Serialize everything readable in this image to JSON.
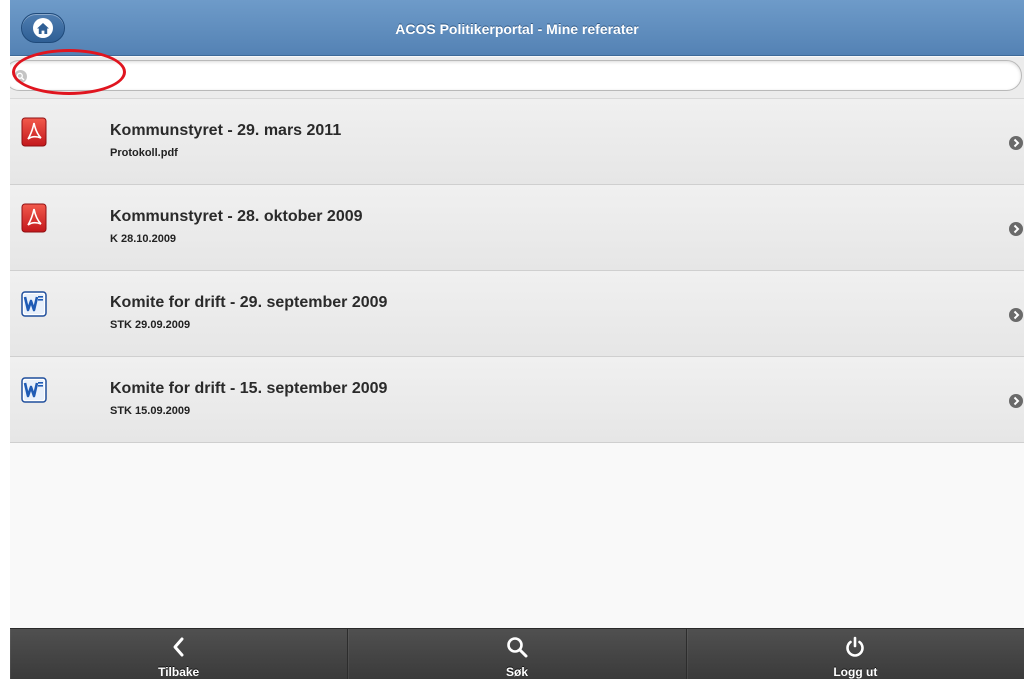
{
  "header": {
    "title": "ACOS Politikerportal - Mine referater",
    "home_icon": "home-icon"
  },
  "search": {
    "placeholder": "",
    "value": "",
    "icon": "search-icon"
  },
  "items": [
    {
      "title": "Kommunstyret - 29. mars 2011",
      "subtitle": "Protokoll.pdf",
      "file_type": "pdf-icon"
    },
    {
      "title": "Kommunstyret - 28. oktober 2009",
      "subtitle": "K 28.10.2009",
      "file_type": "pdf-icon"
    },
    {
      "title": "Komite for drift - 29. september 2009",
      "subtitle": "STK 29.09.2009",
      "file_type": "word-icon"
    },
    {
      "title": "Komite for drift - 15. september 2009",
      "subtitle": "STK 15.09.2009",
      "file_type": "word-icon"
    }
  ],
  "footer": {
    "back_label": "Tilbake",
    "search_label": "Søk",
    "logout_label": "Logg ut"
  },
  "colors": {
    "header": "#5f8fc0",
    "highlight": "#e0151f",
    "footer": "#454545"
  }
}
